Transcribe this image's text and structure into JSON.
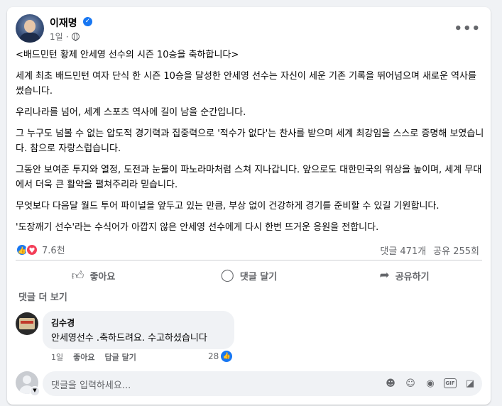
{
  "post": {
    "author": "이재명",
    "time": "1일",
    "time_separator": "·",
    "title_line": "<배드민턴 황제 안세영 선수의 시즌 10승을 축하합니다>",
    "paragraphs": [
      "세계 최초 배드민턴 여자 단식 한 시즌 10승을 달성한 안세영 선수는 자신이 세운 기존 기록을 뛰어넘으며 새로운 역사를 썼습니다.",
      "우리나라를 넘어, 세계 스포츠 역사에 길이 남을 순간입니다.",
      "그 누구도 넘볼 수 없는 압도적 경기력과 집중력으로 '적수가 없다'는 찬사를 받으며 세계 최강임을 스스로 증명해 보였습니다. 참으로 자랑스럽습니다.",
      "그동안 보여준 투지와 열정, 도전과 눈물이 파노라마처럼 스쳐 지나갑니다. 앞으로도 대한민국의 위상을 높이며, 세계 무대에서 더욱 큰 활약을 펼쳐주리라 믿습니다.",
      "무엇보다 다음달 월드 투어 파이널을 앞두고 있는 만큼, 부상 없이 건강하게 경기를 준비할 수 있길 기원합니다.",
      "'도장깨기 선수'라는 수식어가 아깝지 않은 안세영 선수에게 다시 한번 뜨거운 응원을 전합니다."
    ],
    "reaction_count": "7.6천",
    "comment_count": "댓글 471개",
    "share_count": "공유 255회"
  },
  "actions": {
    "like": "좋아요",
    "comment": "댓글 달기",
    "share": "공유하기"
  },
  "comments": {
    "more_label": "댓글 더 보기",
    "items": [
      {
        "name": "김수경",
        "text": "안세영선수 .축하드려요. 수고하셨습니다",
        "time": "1일",
        "like_action": "좋아요",
        "reply_action": "답글 달기",
        "likes": "28"
      }
    ]
  },
  "composer": {
    "placeholder": "댓글을 입력하세요..."
  },
  "icons": [
    "verified-badge-icon",
    "globe-icon",
    "more-options-icon",
    "like-reaction-icon",
    "love-reaction-icon",
    "thumbs-up-icon",
    "comment-bubble-icon",
    "share-arrow-icon",
    "chevron-down-icon",
    "emoji-icon",
    "sticker-icon",
    "camera-icon",
    "gif-icon",
    "avatar-sticker-icon"
  ],
  "colors": {
    "accent": "#1877f2",
    "love": "#f33e58",
    "secondary_text": "#65676b",
    "background": "#f0f2f5"
  }
}
